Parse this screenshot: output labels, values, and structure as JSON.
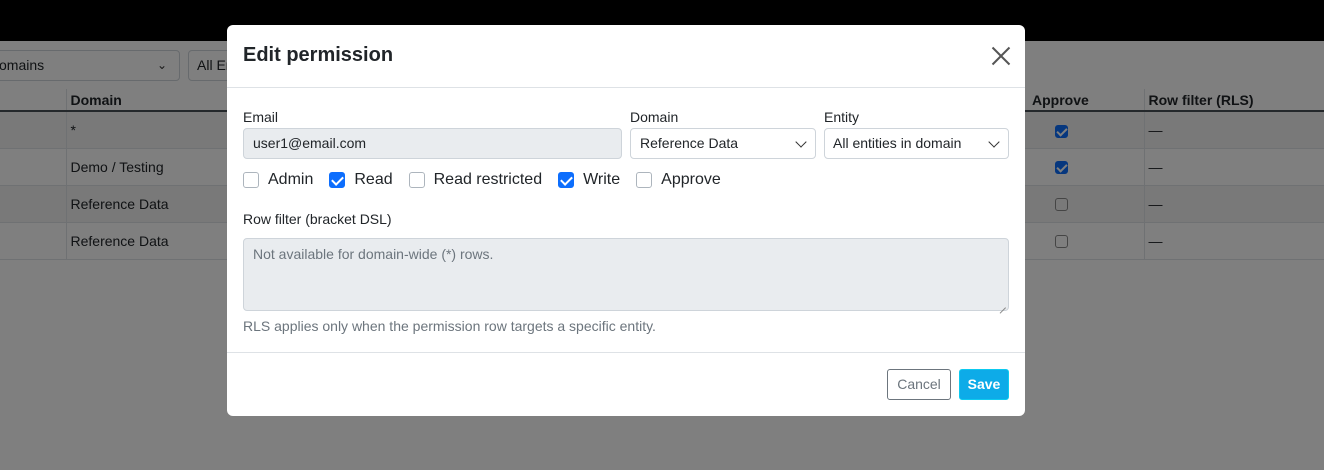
{
  "background": {
    "filters": {
      "domains_select": "omains",
      "entities_select": "All En"
    },
    "table": {
      "headers": {
        "domain": "Domain",
        "approve": "Approve",
        "rls": "Row filter (RLS)"
      },
      "rows": [
        {
          "domain": "*",
          "approve": true,
          "rls": "—"
        },
        {
          "domain": "Demo / Testing",
          "approve": true,
          "rls": "—"
        },
        {
          "domain": "Reference Data",
          "approve": false,
          "rls": "—"
        },
        {
          "domain": "Reference Data",
          "approve": false,
          "rls": "—"
        }
      ]
    }
  },
  "modal": {
    "title": "Edit permission",
    "close_icon": "close-icon",
    "email": {
      "label": "Email",
      "value": "user1@email.com"
    },
    "domain": {
      "label": "Domain",
      "value": "Reference Data"
    },
    "entity": {
      "label": "Entity",
      "value": "All entities in domain"
    },
    "permissions": [
      {
        "key": "admin",
        "label": "Admin",
        "checked": false
      },
      {
        "key": "read",
        "label": "Read",
        "checked": true
      },
      {
        "key": "read-restricted",
        "label": "Read restricted",
        "checked": false
      },
      {
        "key": "write",
        "label": "Write",
        "checked": true
      },
      {
        "key": "approve",
        "label": "Approve",
        "checked": false
      }
    ],
    "row_filter": {
      "label": "Row filter (bracket DSL)",
      "placeholder": "Not available for domain-wide (*) rows.",
      "help": "RLS applies only when the permission row targets a specific entity."
    },
    "buttons": {
      "cancel": "Cancel",
      "save": "Save"
    }
  },
  "colors": {
    "primary": "#0d6efd",
    "save": "#0dabe8",
    "backdrop": "#000000"
  }
}
